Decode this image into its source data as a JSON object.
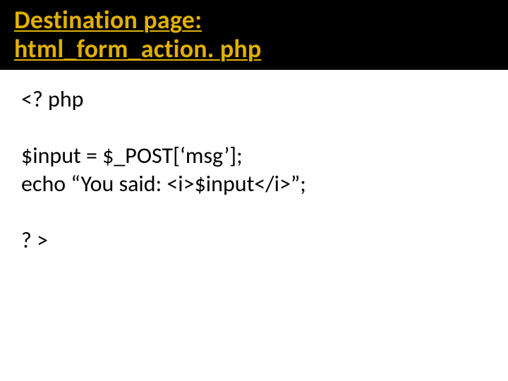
{
  "title": {
    "line1": "Destination page:",
    "line2": "html_form_action. php"
  },
  "code": {
    "l1": "<? php",
    "l2": "$input = $_POST[‘msg’];",
    "l3": "echo “You said: <i>$input</i>”;",
    "l4": "? >"
  }
}
